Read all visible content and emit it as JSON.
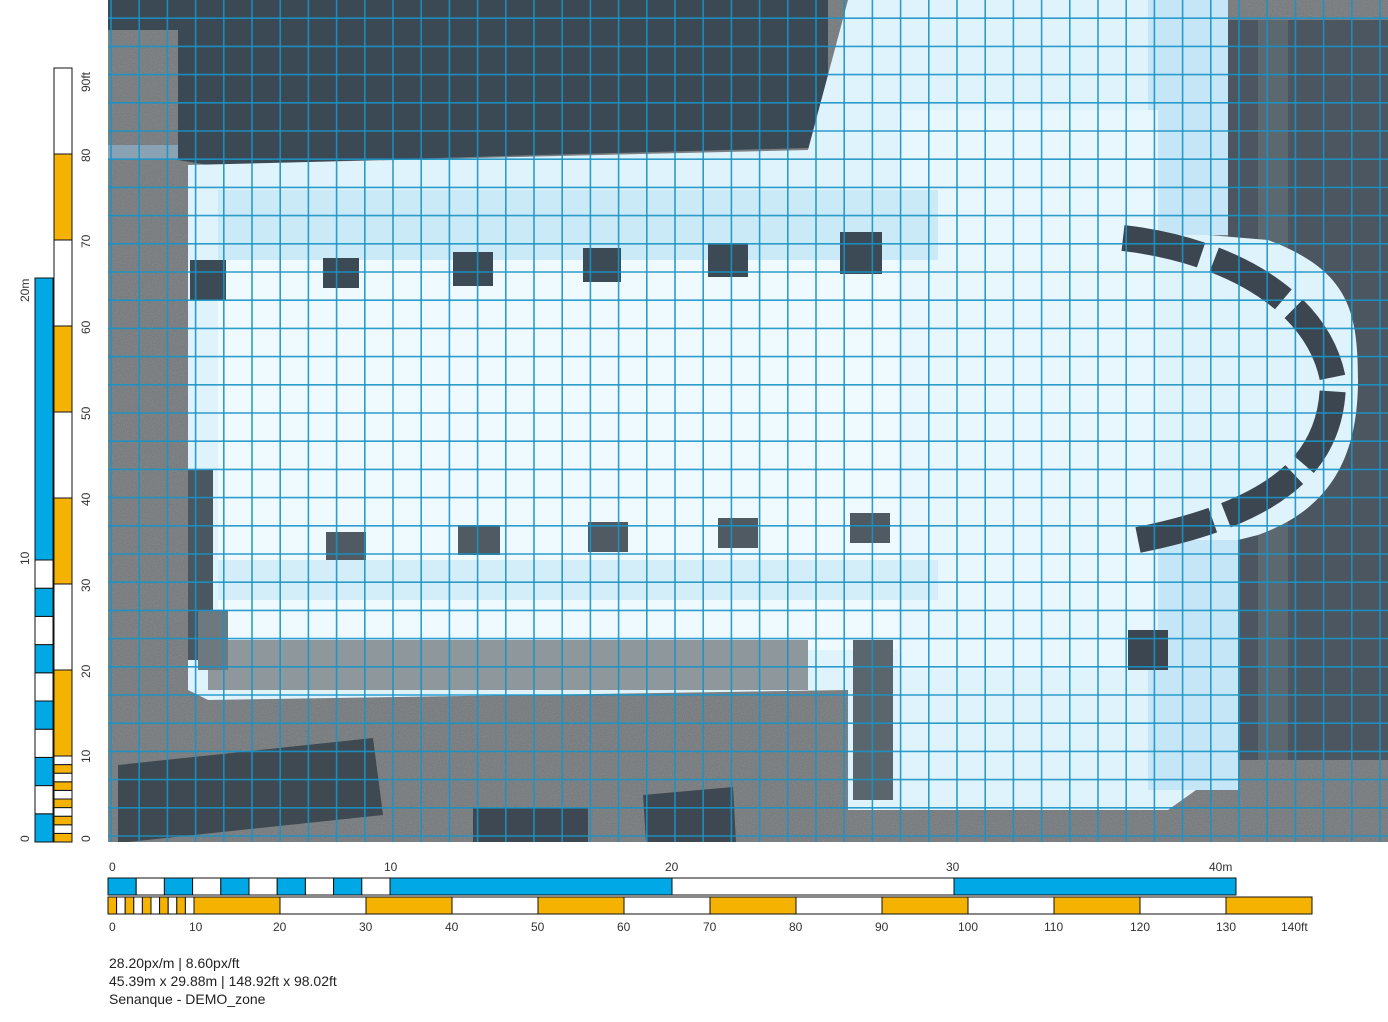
{
  "plan": {
    "name": "Senanque - DEMO_zone",
    "image_description_colors": {
      "background_gray": "#6f7478",
      "dark_roof": "#3c4a55",
      "scan_light": "#e4f6fd",
      "scan_cyan": "#bfe6f7",
      "grid_line": "#1f97c9"
    }
  },
  "colors": {
    "metric_fill": "#00a8e6",
    "imperial_fill": "#f5b200",
    "frame": "#111111",
    "grid": "#1a93c6"
  },
  "scale_horizontal_metric": {
    "tick_labels": [
      "0",
      "10",
      "20",
      "30",
      "40m"
    ]
  },
  "scale_horizontal_imperial": {
    "tick_labels": [
      "0",
      "10",
      "20",
      "30",
      "40",
      "50",
      "60",
      "70",
      "80",
      "90",
      "100",
      "110",
      "120",
      "130",
      "140ft"
    ]
  },
  "scale_vertical_metric": {
    "tick_labels": [
      "0",
      "10",
      "20m"
    ]
  },
  "scale_vertical_imperial": {
    "tick_labels": [
      "0",
      "10",
      "20",
      "30",
      "40",
      "50",
      "60",
      "70",
      "80",
      "90ft"
    ]
  },
  "info": {
    "line1": "28.20px/m | 8.60px/ft",
    "line2": "45.39m x 29.88m | 148.92ft x 98.02ft",
    "line3": "Senanque - DEMO_zone"
  }
}
